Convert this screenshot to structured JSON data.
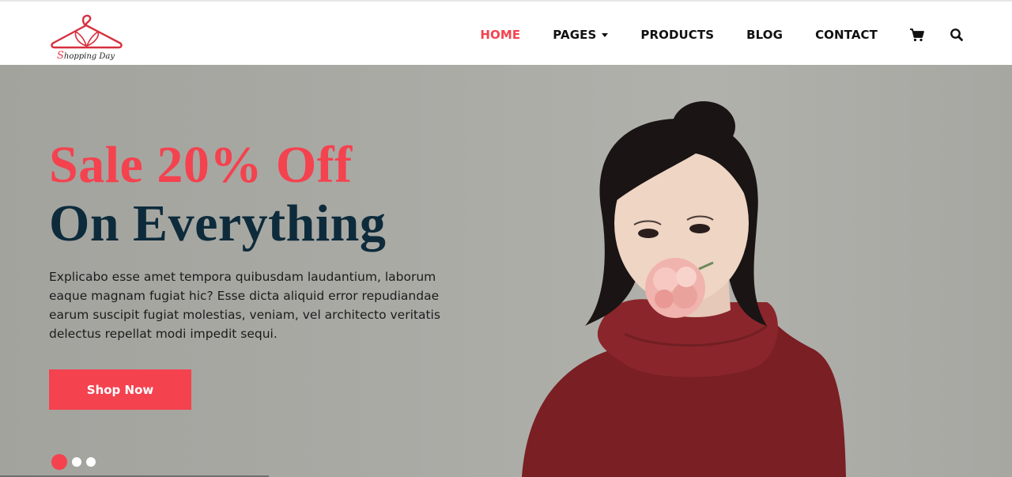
{
  "brand": {
    "name_first_letter": "S",
    "name_rest": "hopping Day"
  },
  "nav": {
    "items": [
      {
        "label": "HOME",
        "active": true,
        "dropdown": false
      },
      {
        "label": "PAGES",
        "active": false,
        "dropdown": true
      },
      {
        "label": "PRODUCTS",
        "active": false,
        "dropdown": false
      },
      {
        "label": "BLOG",
        "active": false,
        "dropdown": false
      },
      {
        "label": "CONTACT",
        "active": false,
        "dropdown": false
      }
    ],
    "icons": [
      "cart-icon",
      "search-icon"
    ]
  },
  "hero": {
    "title_line1": "Sale 20% Off",
    "title_line2": "On Everything",
    "description": "Explicabo esse amet tempora quibusdam laudantium, laborum eaque magnam fugiat hic? Esse dicta aliquid error repudiandae earum suscipit fugiat molestias, veniam, vel architecto veritatis delectus repellat modi impedit sequi.",
    "cta_label": "Shop Now",
    "slides_count": 3,
    "active_slide": 1
  },
  "colors": {
    "accent": "#f4424f",
    "title_dark": "#0d2b3b",
    "hero_bg": "#aaaaa5",
    "sweater": "#7a1f24"
  }
}
